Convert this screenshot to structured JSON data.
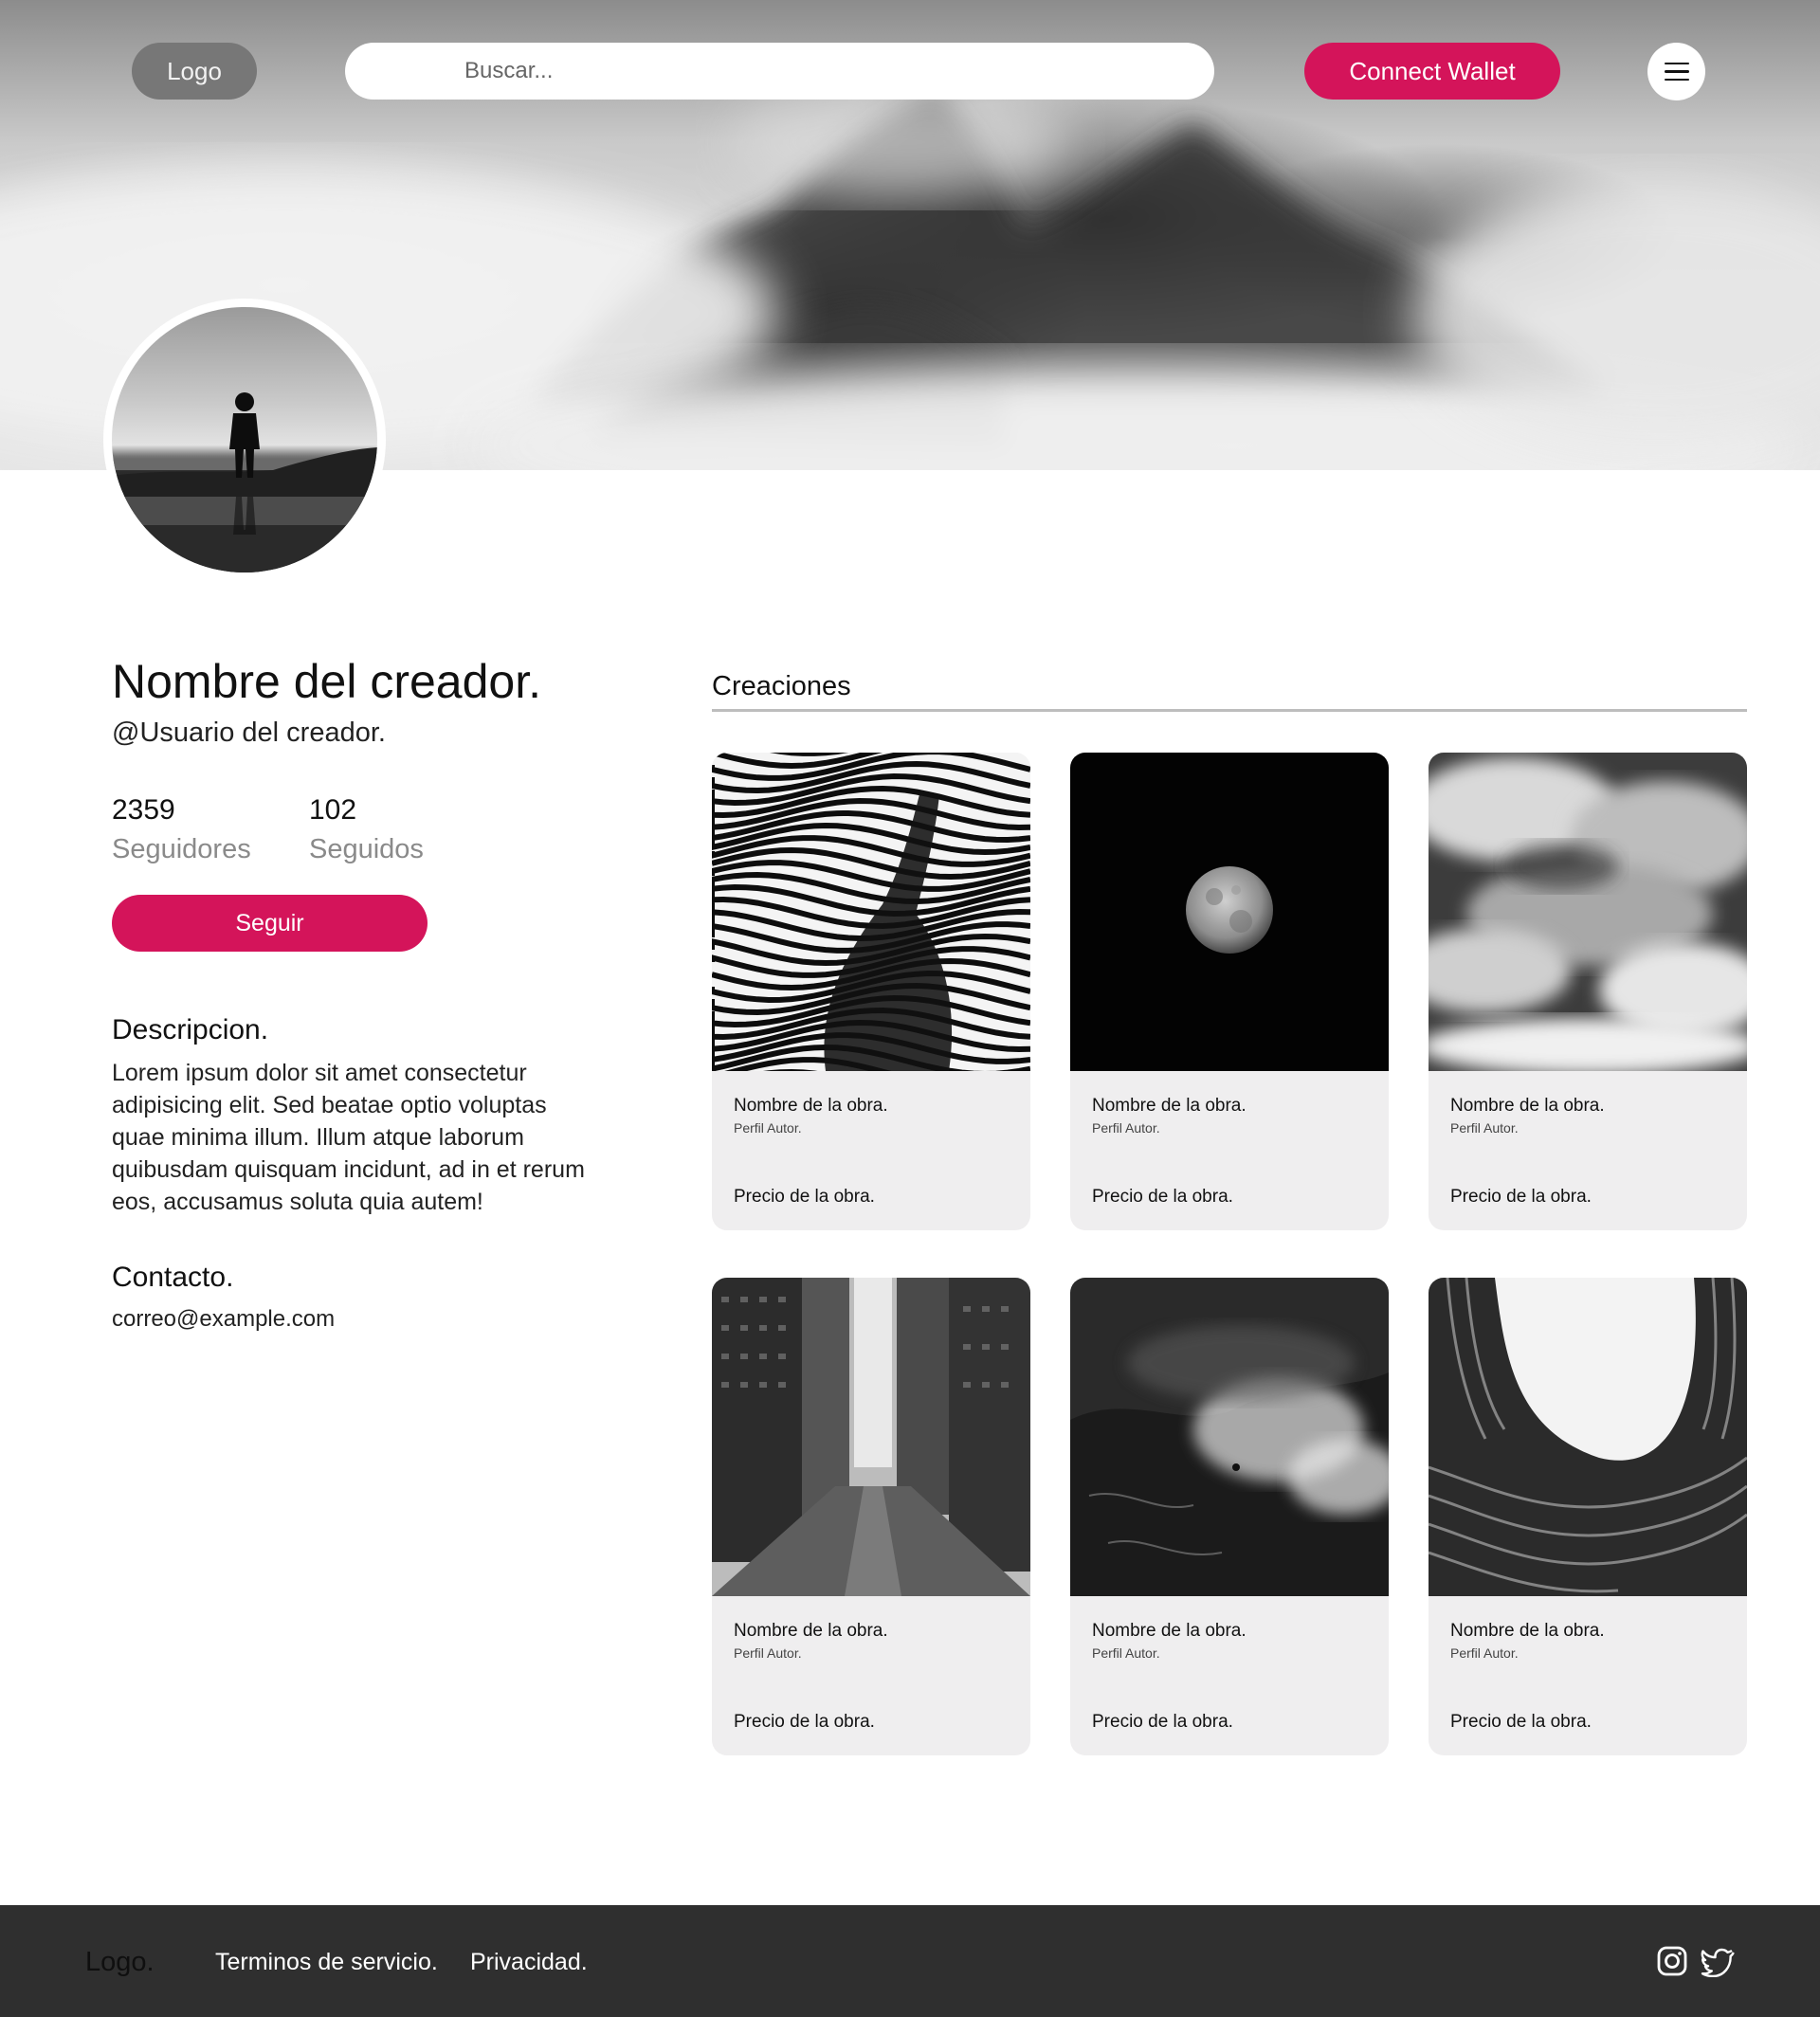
{
  "header": {
    "logo_label": "Logo",
    "search": {
      "placeholder": "Buscar..."
    },
    "connect_wallet_label": "Connect Wallet",
    "menu_icon": "hamburger-menu-icon"
  },
  "profile": {
    "name": "Nombre del creador.",
    "username": "@Usuario del creador.",
    "stats": [
      {
        "value": "2359",
        "label": "Seguidores"
      },
      {
        "value": "102",
        "label": "Seguidos"
      }
    ],
    "follow_label": "Seguir",
    "description_heading": "Descripcion.",
    "description": "Lorem ipsum dolor sit amet consectetur adipisicing elit. Sed beatae optio voluptas quae minima illum. Illum atque laborum quibusdam quisquam incidunt, ad in et rerum eos, accusamus soluta quia autem!",
    "contact_heading": "Contacto.",
    "email": "correo@example.com"
  },
  "creations": {
    "heading": "Creaciones",
    "items": [
      {
        "title": "Nombre de la obra.",
        "author": "Perfil Autor.",
        "price": "Precio de la obra."
      },
      {
        "title": "Nombre de la obra.",
        "author": "Perfil Autor.",
        "price": "Precio de la obra."
      },
      {
        "title": "Nombre de la obra.",
        "author": "Perfil Autor.",
        "price": "Precio de la obra."
      },
      {
        "title": "Nombre de la obra.",
        "author": "Perfil Autor.",
        "price": "Precio de la obra."
      },
      {
        "title": "Nombre de la obra.",
        "author": "Perfil Autor.",
        "price": "Precio de la obra."
      },
      {
        "title": "Nombre de la obra.",
        "author": "Perfil Autor.",
        "price": "Precio de la obra."
      }
    ]
  },
  "footer": {
    "logo": "Logo.",
    "links": [
      "Terminos de servicio.",
      "Privacidad."
    ],
    "social_icons": [
      "instagram-icon",
      "twitter-icon"
    ]
  },
  "colors": {
    "accent": "#d4145a",
    "footer_bg": "#2f2f2f",
    "card_bg": "#efeeef"
  }
}
